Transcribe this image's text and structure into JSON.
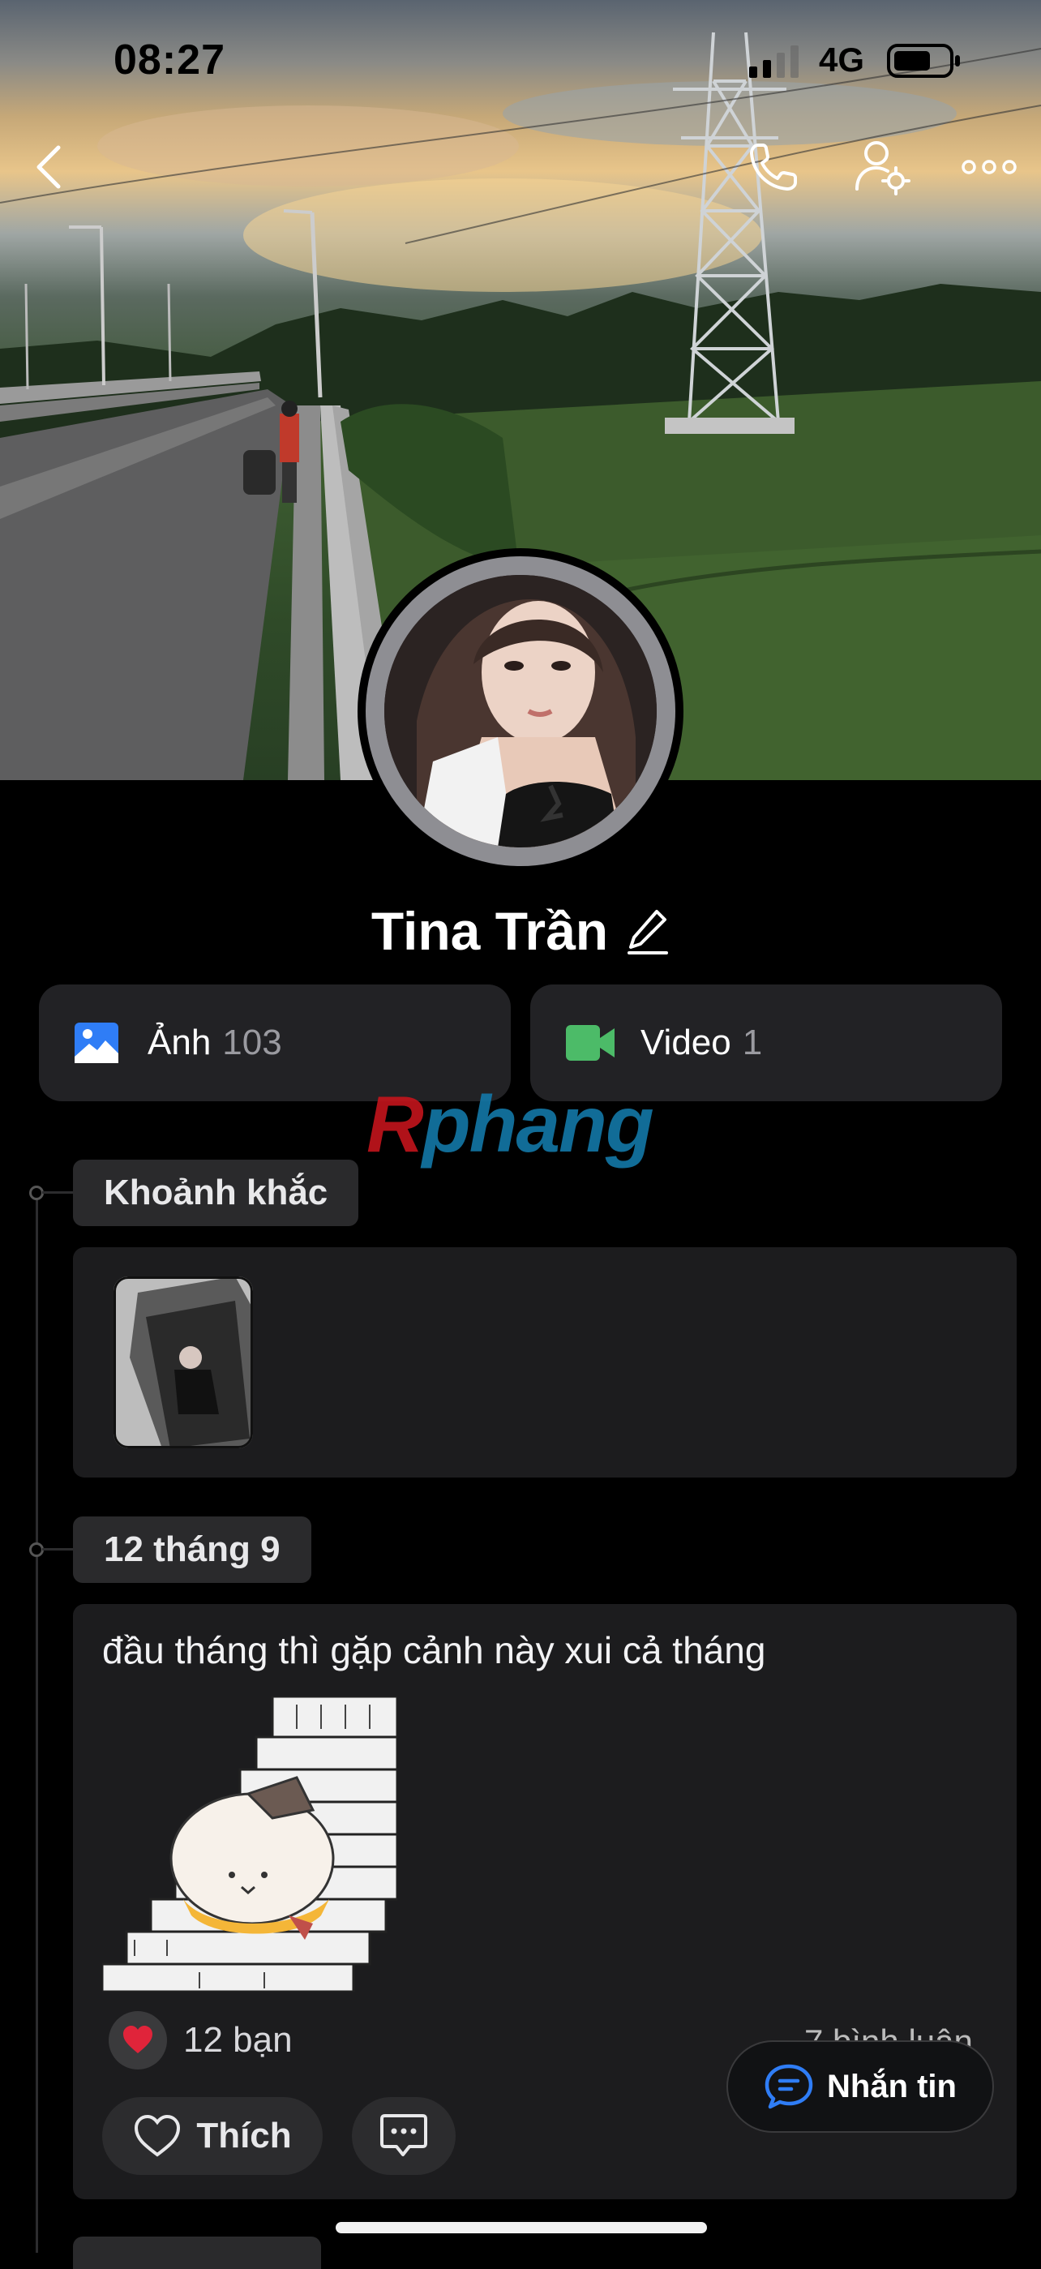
{
  "status_bar": {
    "time": "08:27",
    "network": "4G"
  },
  "profile": {
    "name": "Tina Trần"
  },
  "media": {
    "photos_label": "Ảnh",
    "photos_count": "103",
    "videos_label": "Video",
    "videos_count": "1"
  },
  "watermark": {
    "first": "R",
    "rest": "phang"
  },
  "timeline": {
    "moments_label": "Khoảnh khắc",
    "date_label": "12 tháng 9"
  },
  "post": {
    "text": "đầu tháng thì gặp cảnh này xui cả tháng",
    "reactions": "12 bạn",
    "comments": "7 bình luận",
    "like_label": "Thích"
  },
  "message_button": {
    "label": "Nhắn tin"
  },
  "icons": {
    "back": "chevron-left-icon",
    "call": "phone-icon",
    "settings": "user-settings-icon",
    "more": "more-horizontal-icon",
    "edit": "pencil-icon",
    "photo": "photo-icon",
    "video": "video-camera-icon",
    "heart": "heart-icon",
    "comment": "comment-icon",
    "message": "chat-bubble-icon"
  },
  "colors": {
    "photo_icon": "#2f7df6",
    "video_icon": "#4cbb68",
    "heart": "#e0243a",
    "accent": "#2f7df6"
  }
}
